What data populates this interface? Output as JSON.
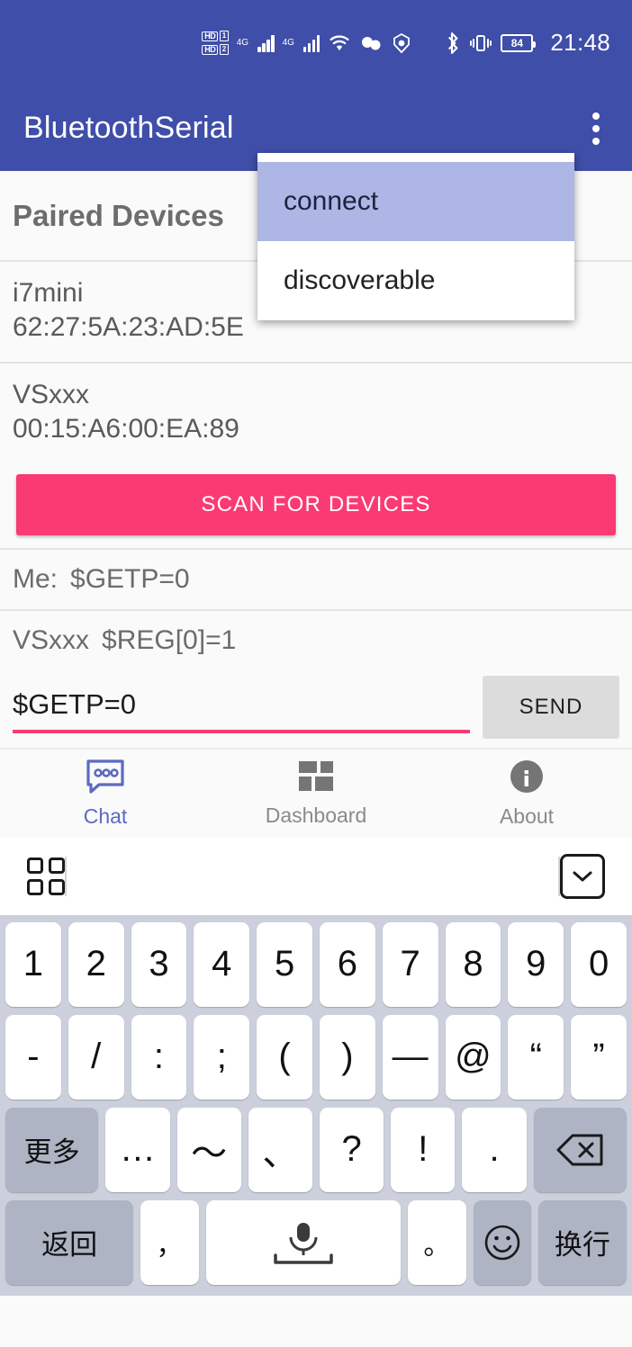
{
  "status_bar": {
    "hd1": "HD",
    "sim1": "1",
    "hd2": "HD",
    "sim2": "2",
    "signal1_label": "4G",
    "signal2_label": "4G",
    "battery": "84",
    "time": "21:48"
  },
  "app_bar": {
    "title": "BluetoothSerial"
  },
  "menu": {
    "items": [
      {
        "label": "connect",
        "selected": true
      },
      {
        "label": "discoverable",
        "selected": false
      }
    ]
  },
  "paired": {
    "header": "Paired Devices",
    "devices": [
      {
        "name": "i7mini",
        "mac": "62:27:5A:23:AD:5E"
      },
      {
        "name": "VSxxx",
        "mac": "00:15:A6:00:EA:89"
      }
    ],
    "scan_label": "SCAN FOR DEVICES"
  },
  "chat": {
    "messages": [
      {
        "who": "Me:",
        "text": "$GETP=0"
      },
      {
        "who": "VSxxx",
        "text": "$REG[0]=1"
      }
    ],
    "input_value": "$GETP=0",
    "input_placeholder": "",
    "send_label": "SEND"
  },
  "bottom_nav": {
    "items": [
      {
        "label": "Chat",
        "icon": "chat-bubble-icon",
        "active": true
      },
      {
        "label": "Dashboard",
        "icon": "grid-dashboard-icon",
        "active": false
      },
      {
        "label": "About",
        "icon": "info-circle-icon",
        "active": false
      }
    ]
  },
  "keyboard": {
    "toolbar": {
      "left_icon": "app-grid-icon",
      "right_icon": "hide-keyboard-chevron-icon"
    },
    "row1": [
      "1",
      "2",
      "3",
      "4",
      "5",
      "6",
      "7",
      "8",
      "9",
      "0"
    ],
    "row2": [
      "-",
      "/",
      ":",
      ";",
      "(",
      ")",
      "—",
      "@",
      "“",
      "”"
    ],
    "row3": [
      "更多",
      "…",
      "～",
      "、",
      "?",
      "!",
      "."
    ],
    "row3_backspace": "backspace-icon",
    "row4": {
      "return_key": "返回",
      "comma_key": "，",
      "space_key": "microphone-space-icon",
      "period_key": "。",
      "emoji_key": "smiley-icon",
      "newline_key": "换行"
    }
  },
  "colors": {
    "app_bar": "#3f4ea8",
    "accent_pink": "#fa3a73",
    "menu_highlight": "#adb6e4",
    "nav_active": "#5c6bc0",
    "keyboard_bg": "#ccd0dc"
  }
}
